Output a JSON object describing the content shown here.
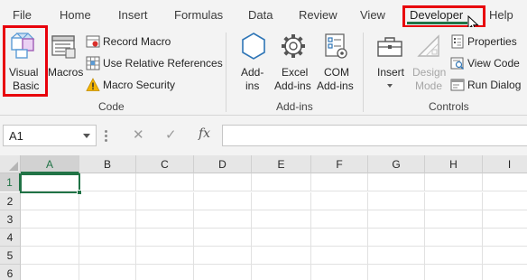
{
  "tabs": [
    "File",
    "Home",
    "Insert",
    "Formulas",
    "Data",
    "Review",
    "View",
    "Developer",
    "Help"
  ],
  "active_tab": "Developer",
  "ribbon": {
    "code": {
      "visual_basic": [
        "Visual",
        "Basic"
      ],
      "macros": "Macros",
      "record_macro": "Record Macro",
      "use_relative_references": "Use Relative References",
      "macro_security": "Macro Security",
      "group_label": "Code"
    },
    "addins": {
      "addins": [
        "Add-",
        "ins"
      ],
      "excel_addins": [
        "Excel",
        "Add-ins"
      ],
      "com_addins": [
        "COM",
        "Add-ins"
      ],
      "group_label": "Add-ins"
    },
    "controls": {
      "insert": "Insert",
      "design_mode": [
        "Design",
        "Mode"
      ],
      "properties": "Properties",
      "view_code": "View Code",
      "run_dialog": "Run Dialog",
      "group_label": "Controls"
    }
  },
  "formula_bar": {
    "name_box": "A1",
    "fx": "fx",
    "formula": ""
  },
  "grid": {
    "columns": [
      "A",
      "B",
      "C",
      "D",
      "E",
      "F",
      "G",
      "H",
      "I"
    ],
    "rows": [
      "1",
      "2",
      "3",
      "4",
      "5",
      "6"
    ],
    "active_cell": "A1"
  },
  "colors": {
    "accent": "#217346",
    "highlight": "#e8000b",
    "ribbon_bg": "#f3f3f3"
  }
}
